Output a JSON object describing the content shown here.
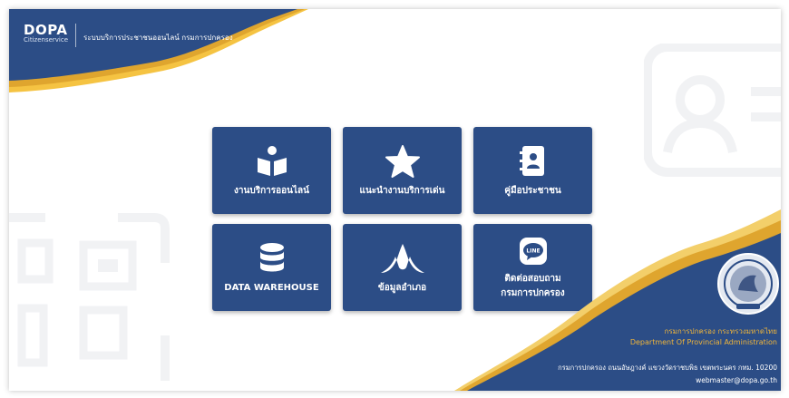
{
  "brand": {
    "logo": "DOPA",
    "logo_sub": "Citizenservice",
    "title": "ระบบบริการประชาชนออนไลน์ กรมการปกครอง"
  },
  "tiles": [
    {
      "label": "งานบริการออนไลน์",
      "icon": "reading-book-icon"
    },
    {
      "label": "แนะนำงานบริการเด่น",
      "icon": "star-icon"
    },
    {
      "label": "คู่มือประชาชน",
      "icon": "address-book-icon"
    },
    {
      "label": "DATA WAREHOUSE",
      "icon": "database-icon"
    },
    {
      "label": "ข้อมูลอำเภอ",
      "icon": "thai-roof-icon"
    },
    {
      "label_line1": "ติดต่อสอบถาม",
      "label_line2": "กรมการปกครอง",
      "icon": "line-chat-icon"
    }
  ],
  "footer": {
    "org_th": "กรมการปกครอง กระทรวงมหาดไทย",
    "org_en": "Department Of Provincial Administration",
    "address": "กรมการปกครอง ถนนอัษฎางค์ แขวงวัดราชบพิธ เขตพระนคร กทม. 10200",
    "email": "webmaster@dopa.go.th"
  },
  "colors": {
    "navy": "#2c4d86",
    "gold": "#e8a82e",
    "watermark": "#f1f2f4"
  }
}
